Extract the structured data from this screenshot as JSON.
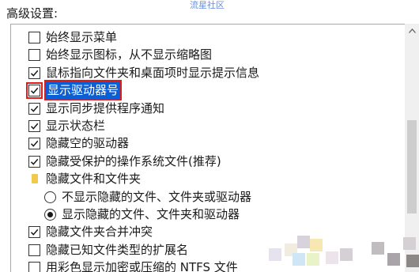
{
  "section_label": "高级设置:",
  "watermark": "流星社区",
  "accent_color": "#0a5fd4",
  "annotation_color": "#e01b1b",
  "items": [
    {
      "type": "checkbox",
      "checked": false,
      "label": "始终显示菜单"
    },
    {
      "type": "checkbox",
      "checked": false,
      "label": "始终显示图标，从不显示缩略图"
    },
    {
      "type": "checkbox",
      "checked": true,
      "label": "鼠标指向文件夹和桌面项时显示提示信息"
    },
    {
      "type": "checkbox",
      "checked": true,
      "label": "显示驱动器号",
      "selected": true
    },
    {
      "type": "checkbox",
      "checked": true,
      "label": "显示同步提供程序通知"
    },
    {
      "type": "checkbox",
      "checked": true,
      "label": "显示状态栏"
    },
    {
      "type": "checkbox",
      "checked": true,
      "label": "隐藏空的驱动器"
    },
    {
      "type": "checkbox",
      "checked": true,
      "label": "隐藏受保护的操作系统文件(推荐)"
    },
    {
      "type": "folder",
      "label": "隐藏文件和文件夹"
    },
    {
      "type": "radio",
      "checked": false,
      "label": "不显示隐藏的文件、文件夹或驱动器"
    },
    {
      "type": "radio",
      "checked": true,
      "label": "显示隐藏的文件、文件夹和驱动器"
    },
    {
      "type": "checkbox",
      "checked": true,
      "label": "隐藏文件夹合并冲突"
    },
    {
      "type": "checkbox",
      "checked": false,
      "label": "隐藏已知文件类型的扩展名"
    },
    {
      "type": "checkbox",
      "checked": false,
      "label": "用彩色显示加密或压缩的 NTFS 文件"
    }
  ]
}
